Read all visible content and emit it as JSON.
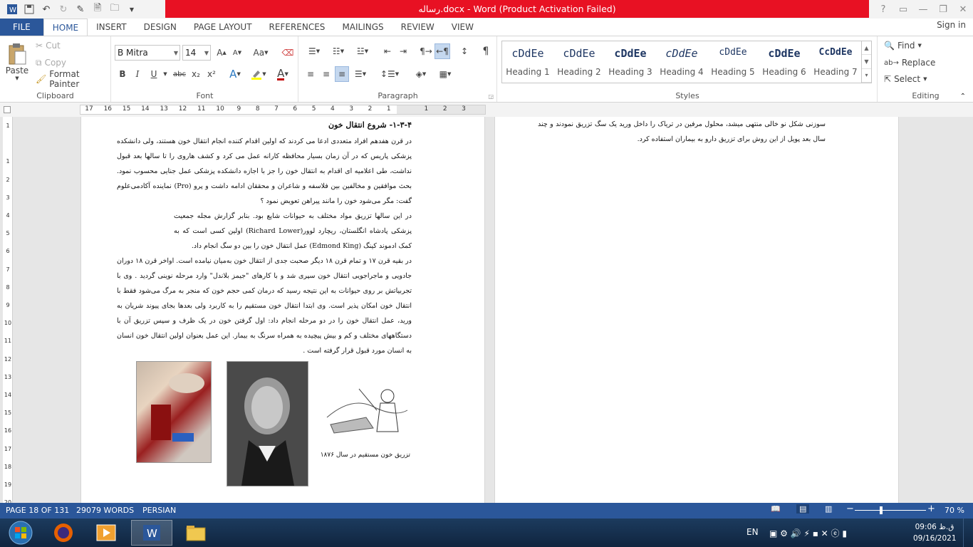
{
  "titlebar": {
    "title": "رساله.docx - Word (Product Activation Failed)",
    "help": "?"
  },
  "tabs": [
    "FILE",
    "HOME",
    "INSERT",
    "DESIGN",
    "PAGE LAYOUT",
    "REFERENCES",
    "MAILINGS",
    "REVIEW",
    "VIEW"
  ],
  "signin": "Sign in",
  "clipboard": {
    "paste": "Paste",
    "cut": "Cut",
    "copy": "Copy",
    "format_painter": "Format Painter",
    "label": "Clipboard"
  },
  "font": {
    "name": "B Mitra",
    "size": "14",
    "label": "Font",
    "bold": "B",
    "italic": "I",
    "underline": "U",
    "strike": "abc",
    "sub": "x₂",
    "sup": "x²",
    "grow": "A",
    "shrink": "A",
    "case": "Aa",
    "color_accent": "#c00000"
  },
  "paragraph": {
    "label": "Paragraph",
    "pilcrow": "¶"
  },
  "styles": {
    "label": "Styles",
    "items": [
      {
        "preview": "cDdEe",
        "name": "Heading 1"
      },
      {
        "preview": "cDdEe",
        "name": "Heading 2"
      },
      {
        "preview": "cDdEe",
        "name": "Heading 3"
      },
      {
        "preview": "cDdEe",
        "name": "Heading 4"
      },
      {
        "preview": "cDdEe",
        "name": "Heading 5"
      },
      {
        "preview": "cDdEe",
        "name": "Heading 6"
      },
      {
        "preview": "CcDdEe",
        "name": "Heading 7"
      }
    ]
  },
  "editing": {
    "label": "Editing",
    "find": "Find",
    "replace": "Replace",
    "select": "Select"
  },
  "ruler_h": [
    "17",
    "16",
    "15",
    "14",
    "13",
    "12",
    "11",
    "10",
    "9",
    "8",
    "7",
    "6",
    "5",
    "4",
    "3",
    "2",
    "1",
    "",
    "1",
    "2",
    "3"
  ],
  "ruler_v": [
    "1",
    "",
    "1",
    "2",
    "3",
    "4",
    "5",
    "6",
    "7",
    "8",
    "9",
    "10",
    "11",
    "12",
    "13",
    "14",
    "15",
    "16",
    "17",
    "18",
    "19",
    "20"
  ],
  "page1": {
    "heading": "۱-۳-۴- شروع انتقال خون",
    "para1": "در قرن هفدهم افراد متعددی ادعا می کردند که اولین اقدام کننده انجام انتقال خون هستند، ولی دانشکده پزشکی پاریس که در آن زمان بسیار محافظه کارانه عمل می کرد و کشف هاروی را تا سالها بعد قبول نداشت، طی اعلامیه ای اقدام به انتقال خون را جز با اجازه دانشکده پزشکی عمل جنایی محسوب نمود. بحث موافقین و مخالفین بین فلاسفه و شاعران و محققان ادامه داشت و پرو (Pro) نماینده آکادمی‌علوم گفت: مگر می‌شود خون را مانند پیراهن تعویض نمود ؟",
    "para2": "در این سالها تزریق مواد مختلف به حیوانات شایع بود. بنابر گزارش مجله جمعیت پزشکی پادشاه انگلستان، ریچارد لوور(Richard Lower) اولین کسی است که به کمک ادموند کینگ (Edmond King) عمل انتقال خون را بین دو سگ انجام داد.",
    "para3": "در بقیه قرن ۱۷ و تمام قرن ۱۸ دیگر صحبت جدی از انتقال خون به‌میان نیامده است. اواخر قرن ۱۸ دوران جادویی و ماجراجویی انتقال خون سپری شد و با کارهای \"جیمز بلاندل\" وارد مرحله نوینی گردید . وی با تجربیاتش بر روی حیوانات به این نتیجه رسید که درمان کمی حجم خون که منجر به مرگ می‌شود فقط با انتقال خون امکان پذیر است. وی ابتدا انتقال خون مستقیم را به کاربرد ولی بعدها بجای پیوند شریان به ورید، عمل انتقال خون را در دو مرحله انجام داد: اول گرفتن خون در یک ظرف و سپس تزریق آن با دستگاههای مختلف و کم و بیش پیچیده به همراه سرنگ به بیمار. این عمل بعنوان اولین انتقال خون انسان به انسان مورد قبول قرار گرفته است .",
    "caption": "تزریق خون مستقیم در سال ۱۸۷۶"
  },
  "page2": {
    "para": "سوزنی شکل نو خالی منتهی میشد، محلول مرفین در تریاک را داخل ورید یک سگ تزریق نمودند و چند سال بعد پویل از این روش برای تزریق دارو به بیماران استفاده کرد."
  },
  "status": {
    "page": "PAGE 18 OF 131",
    "words": "29079 WORDS",
    "lang": "PERSIAN",
    "zoom": "70 %",
    "zoom_level_percent": 70
  },
  "taskbar": {
    "lang": "EN",
    "time": "09:06 ق.ظ",
    "date": "09/16/2021"
  },
  "colors": {
    "accent": "#2b579a",
    "title_red": "#e81123"
  }
}
